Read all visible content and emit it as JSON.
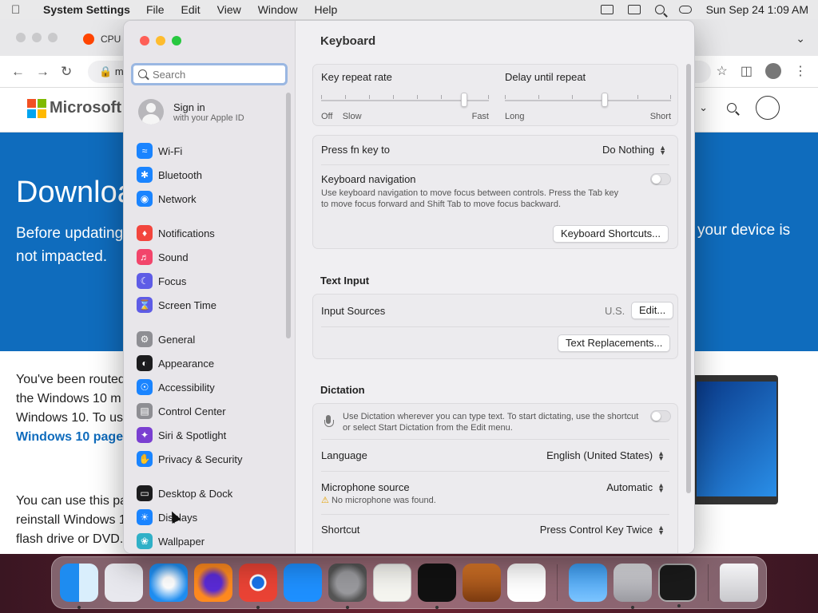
{
  "menubar": {
    "app": "System Settings",
    "menus": [
      "File",
      "Edit",
      "View",
      "Window",
      "Help"
    ],
    "clock": "Sun Sep 24  1:09 AM"
  },
  "browser": {
    "tab_title": "CPU",
    "url": "m",
    "brand": "Microsoft",
    "hero_title": "Downloa",
    "hero_line1": "Before updating",
    "hero_line2": "not impacted.",
    "hero_right": "your device is",
    "body_lines": [
      "You've been routed",
      "the Windows 10 m",
      "Windows 10. To us"
    ],
    "body_link": "Windows 10 page f",
    "body_lines2": [
      "You can use this pa",
      "reinstall Windows 1",
      "flash drive or DVD."
    ]
  },
  "settings": {
    "search_placeholder": "Search",
    "account": {
      "title": "Sign in",
      "subtitle": "with your Apple ID"
    },
    "sidebar": [
      {
        "label": "Wi-Fi",
        "icon": "wifi-icon",
        "color": "#1a84ff"
      },
      {
        "label": "Bluetooth",
        "icon": "bluetooth-icon",
        "color": "#1a84ff"
      },
      {
        "label": "Network",
        "icon": "globe-icon",
        "color": "#1a84ff"
      },
      {
        "label": "Notifications",
        "icon": "bell-icon",
        "color": "#f2453d"
      },
      {
        "label": "Sound",
        "icon": "speaker-icon",
        "color": "#f2456b"
      },
      {
        "label": "Focus",
        "icon": "moon-icon",
        "color": "#5e5ce6"
      },
      {
        "label": "Screen Time",
        "icon": "hourglass-icon",
        "color": "#5e5ce6"
      },
      {
        "label": "General",
        "icon": "gear-icon",
        "color": "#8e8e93"
      },
      {
        "label": "Appearance",
        "icon": "appearance-icon",
        "color": "#1c1c1e"
      },
      {
        "label": "Accessibility",
        "icon": "accessibility-icon",
        "color": "#1a84ff"
      },
      {
        "label": "Control Center",
        "icon": "control-center-icon",
        "color": "#8e8e93"
      },
      {
        "label": "Siri & Spotlight",
        "icon": "siri-icon",
        "color": "#7a3fd1"
      },
      {
        "label": "Privacy & Security",
        "icon": "hand-icon",
        "color": "#1a84ff"
      },
      {
        "label": "Desktop & Dock",
        "icon": "dock-icon",
        "color": "#1c1c1e"
      },
      {
        "label": "Displays",
        "icon": "sun-icon",
        "color": "#1a84ff"
      },
      {
        "label": "Wallpaper",
        "icon": "wallpaper-icon",
        "color": "#30b0c7"
      }
    ],
    "page_title": "Keyboard",
    "key_repeat": {
      "label": "Key repeat rate",
      "min": "Off",
      "min2": "Slow",
      "max": "Fast",
      "value": 0.85
    },
    "delay_repeat": {
      "label": "Delay until repeat",
      "min": "Long",
      "max": "Short",
      "value": 0.6
    },
    "fn_key": {
      "label": "Press fn key to",
      "value": "Do Nothing"
    },
    "keyboard_nav": {
      "label": "Keyboard navigation",
      "desc1": "Use keyboard navigation to move focus between controls. Press the Tab key",
      "desc2": "to move focus forward and Shift Tab to move focus backward.",
      "enabled": false
    },
    "shortcuts_button": "Keyboard Shortcuts...",
    "text_input": {
      "title": "Text Input",
      "input_sources_label": "Input Sources",
      "input_sources_value": "U.S.",
      "edit_button": "Edit...",
      "replacements_button": "Text Replacements..."
    },
    "dictation": {
      "title": "Dictation",
      "desc1": "Use Dictation wherever you can type text. To start dictating, use the shortcut",
      "desc2": "or select Start Dictation from the Edit menu.",
      "enabled": false,
      "language_label": "Language",
      "language_value": "English (United States)",
      "mic_label": "Microphone source",
      "mic_value": "Automatic",
      "mic_warning": "No microphone was found.",
      "shortcut_label": "Shortcut",
      "shortcut_value": "Press Control Key Twice"
    }
  }
}
